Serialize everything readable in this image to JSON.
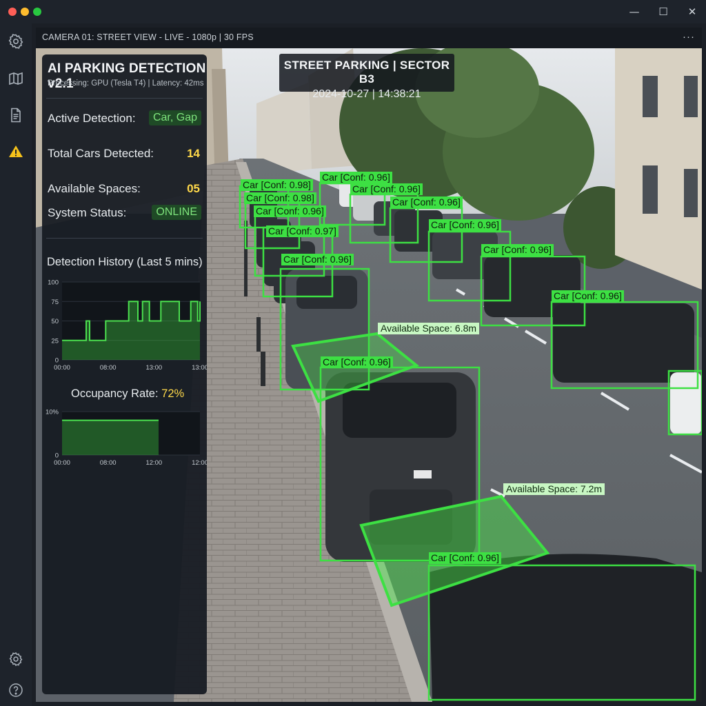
{
  "window": {
    "controls": {
      "minimize": "—",
      "maximize": "☐",
      "close": "✕"
    }
  },
  "sidebar": {
    "icons": [
      "gear-icon",
      "map-icon",
      "document-icon",
      "warning-icon",
      "settings-icon",
      "help-icon"
    ]
  },
  "viewer": {
    "header": "CAMERA 01: STREET VIEW - LIVE - 1080p | 30 FPS",
    "more": "···"
  },
  "overlay": {
    "title": "STREET PARKING | SECTOR B3",
    "datetime": "2024-10-27 | 14:38:21"
  },
  "detections": [
    {
      "label": "Car [Conf: 0.96]"
    },
    {
      "label": "Car [Conf: 0.98]"
    },
    {
      "label": "Car [Conf: 0.96]"
    },
    {
      "label": "Car [Conf: 0.98]"
    },
    {
      "label": "Car [Conf: 0.96]"
    },
    {
      "label": "Car [Conf: 0.96]"
    },
    {
      "label": "Car [Conf: 0.97]"
    },
    {
      "label": "Car [Conf: 0.96]"
    },
    {
      "label": "Car [Conf: 0.96]"
    },
    {
      "label": "Car [Conf: 0.96]"
    },
    {
      "label": "Car [Conf: 0.96]"
    },
    {
      "label": "Car [Conf: 0.96]"
    },
    {
      "label": "Car [Conf: 0.96]"
    }
  ],
  "spaces": [
    {
      "label": "Available Space: 6.8m"
    },
    {
      "label": "Available Space: 7.2m"
    }
  ],
  "panel": {
    "title": "AI PARKING DETECTION v2.1",
    "subtitle": "Processing: GPU (Tesla T4) | Latency: 42ms",
    "active_detection_label": "Active Detection:",
    "active_detection_value": "Car, Gap",
    "total_cars_label": "Total Cars Detected:",
    "total_cars_value": "14",
    "available_spaces_label": "Available Spaces:",
    "available_spaces_value": "05",
    "status_label": "System Status:",
    "status_value": "ONLINE",
    "history_title": "Detection History (Last 5 mins)",
    "occupancy_label": "Occupancy Rate: ",
    "occupancy_value": "72%"
  },
  "colors": {
    "detection_green": "#3de043",
    "accent_yellow": "#ffd94a",
    "online_green": "#7ee37c"
  },
  "chart_data": [
    {
      "type": "area",
      "title": "Detection History (Last 5 mins)",
      "ylim": [
        0,
        100
      ],
      "y_ticks": [
        "100",
        "75",
        "50",
        "25",
        "0"
      ],
      "x_ticks": [
        "00:00",
        "08:00",
        "13:00",
        "13:00"
      ],
      "x": [
        0,
        10,
        10.5,
        11.5,
        12,
        18,
        19,
        28,
        29,
        32,
        33,
        34,
        35,
        37,
        38,
        42,
        43,
        50,
        51,
        55,
        56,
        58,
        59,
        60
      ],
      "values": [
        25,
        25,
        50,
        50,
        25,
        25,
        50,
        50,
        75,
        75,
        50,
        50,
        75,
        75,
        50,
        50,
        75,
        75,
        50,
        50,
        75,
        75,
        50,
        75
      ],
      "xrange": [
        0,
        60
      ],
      "grid": true
    },
    {
      "type": "area",
      "title": "Occupancy Rate: 72%",
      "ylim": [
        0,
        10
      ],
      "y_ticks": [
        "10%",
        "0"
      ],
      "x_ticks": [
        "00:00",
        "08:00",
        "12:00",
        "12:00"
      ],
      "x": [
        0,
        0.7
      ],
      "values": [
        8,
        8
      ],
      "xrange": [
        0,
        1
      ],
      "grid": true
    }
  ]
}
